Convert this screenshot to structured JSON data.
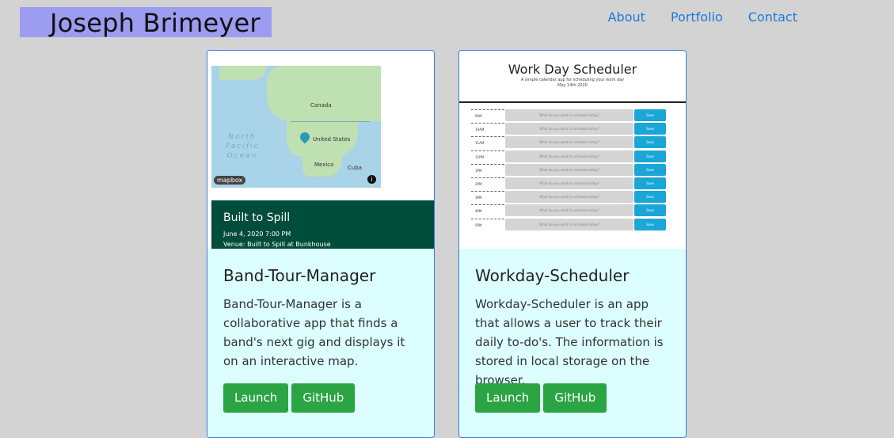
{
  "header": {
    "brand": "Joseph Brimeyer",
    "nav": [
      "About",
      "Portfolio",
      "Contact"
    ]
  },
  "cards": [
    {
      "title": "Band-Tour-Manager",
      "text": "Band-Tour-Manager is a collaborative app that finds a band's next gig and displays it on an interactive map.",
      "launch": "Launch",
      "github": "GitHub",
      "screenshot": {
        "labels": {
          "canada": "Canada",
          "us": "United States",
          "mexico": "Mexico",
          "cuba": "Cuba",
          "ocean": "North Pacific Ocean",
          "mapbox": "mapbox",
          "info": "i"
        },
        "event_title": "Built to Spill",
        "event_date": "June 4, 2020 7:00 PM",
        "event_venue": "Venue: Built to Spill at Bunkhouse"
      }
    },
    {
      "title": "Workday-Scheduler",
      "text": "Workday-Scheduler is an app that allows a user to track their daily to-do's. The information is stored in local storage on the browser.",
      "launch": "Launch",
      "github": "GitHub",
      "screenshot": {
        "title": "Work Day Scheduler",
        "subtitle": "A simple calendar app for scheduling your work day",
        "date": "May 14th 2020",
        "hours": [
          "9AM",
          "10AM",
          "11AM",
          "12PM",
          "1PM",
          "2PM",
          "3PM",
          "4PM",
          "5PM"
        ],
        "placeholder": "What do you want to schedule today?",
        "save": "Save"
      }
    }
  ]
}
